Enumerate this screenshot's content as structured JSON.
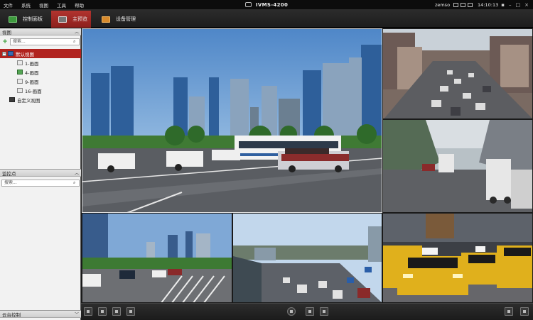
{
  "app": {
    "title": "IVMS-4200"
  },
  "menu": [
    "文件",
    "系统",
    "视图",
    "工具",
    "帮助"
  ],
  "status": {
    "user": "zemso",
    "time": "14:10:13"
  },
  "tabs": [
    {
      "label": "控制面板",
      "icon": "control-panel-icon"
    },
    {
      "label": "主预览",
      "icon": "main-view-icon",
      "active": true
    },
    {
      "label": "设备管理",
      "icon": "device-management-icon"
    }
  ],
  "left": {
    "view_section": {
      "title": "视图",
      "search_placeholder": "搜索...",
      "tree": {
        "root": "默认视图",
        "children": [
          "1-画面",
          "4-画面",
          "9-画面",
          "16-画面"
        ],
        "custom": "自定义视图"
      }
    },
    "camera_section": {
      "title": "监控点",
      "search_placeholder": "搜索..."
    },
    "ptz_section": {
      "title": "云台控制"
    }
  },
  "colors": {
    "accent": "#b1231f",
    "tab_active": "#a02a26",
    "green": "#3d9a3d"
  },
  "toolbar": {
    "left_buttons": [
      "layout-window-icon",
      "layout-grid-icon",
      "stop-all-icon",
      "audio-icon"
    ],
    "center_buttons": [
      "cycle-icon",
      "previous-icon",
      "next-icon"
    ],
    "right_buttons": [
      "layout-menu-icon",
      "fullscreen-icon"
    ]
  }
}
